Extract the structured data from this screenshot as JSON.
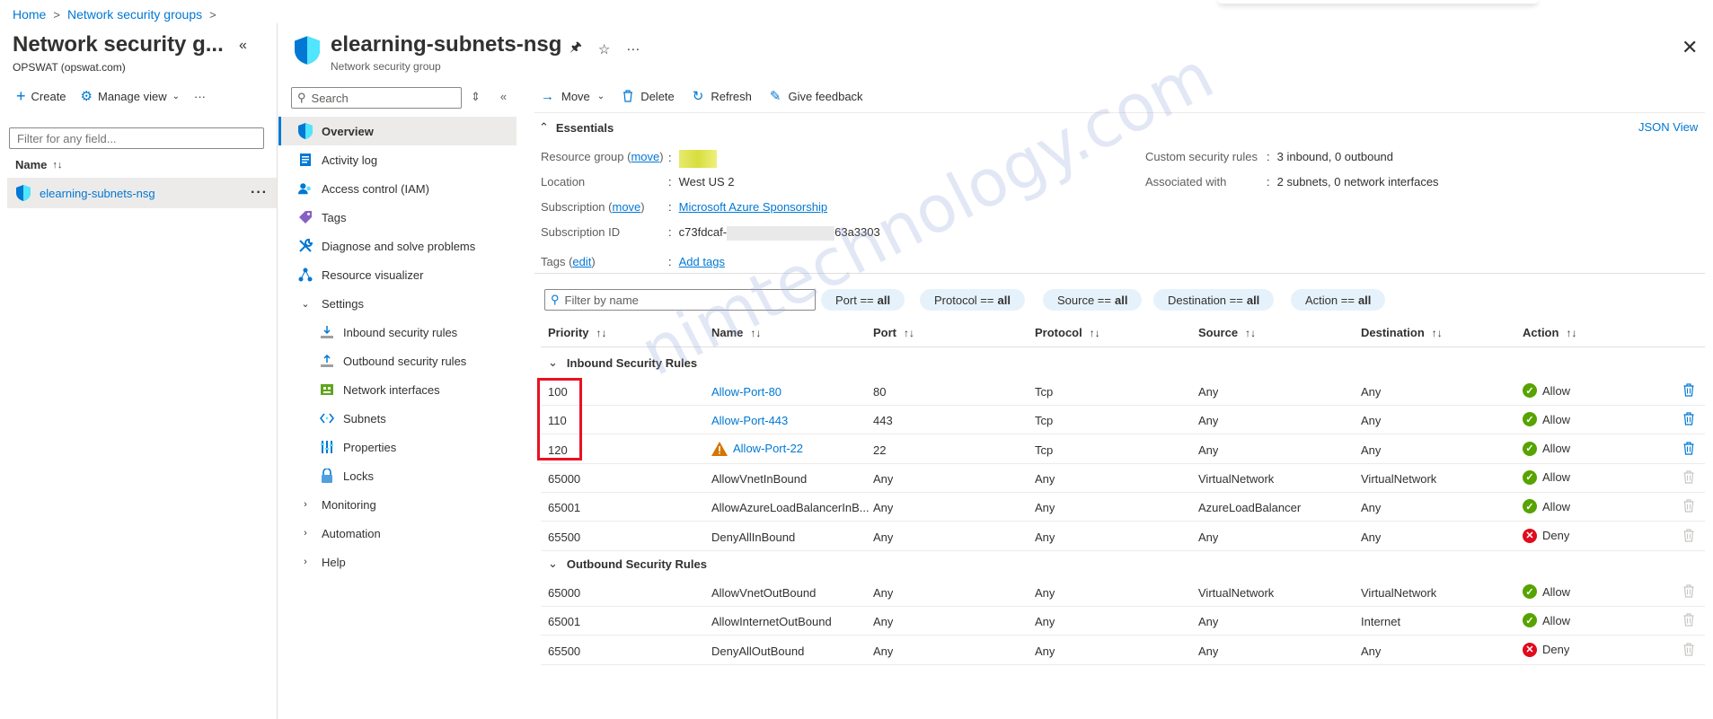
{
  "breadcrumb": {
    "home": "Home",
    "parent": "Network security groups",
    "sep": ">"
  },
  "left_pane": {
    "title": "Network security g...",
    "subtitle": "OPSWAT (opswat.com)",
    "create": "Create",
    "manage_view": "Manage view",
    "more": "···",
    "filter_placeholder": "Filter for any field...",
    "name_header": "Name",
    "item": "elearning-subnets-nsg"
  },
  "resource": {
    "title": "elearning-subnets-nsg",
    "subtitle": "Network security group"
  },
  "menu": {
    "search_placeholder": "Search",
    "items": [
      {
        "label": "Overview",
        "icon": "shield-icon"
      },
      {
        "label": "Activity log",
        "icon": "activity-log-icon"
      },
      {
        "label": "Access control (IAM)",
        "icon": "iam-icon"
      },
      {
        "label": "Tags",
        "icon": "tag-icon"
      },
      {
        "label": "Diagnose and solve problems",
        "icon": "wrench-icon"
      },
      {
        "label": "Resource visualizer",
        "icon": "visualizer-icon"
      },
      {
        "label": "Settings",
        "icon": "chevron-down-icon"
      },
      {
        "label": "Inbound security rules",
        "icon": "inbound-icon"
      },
      {
        "label": "Outbound security rules",
        "icon": "outbound-icon"
      },
      {
        "label": "Network interfaces",
        "icon": "nic-icon"
      },
      {
        "label": "Subnets",
        "icon": "subnet-icon"
      },
      {
        "label": "Properties",
        "icon": "properties-icon"
      },
      {
        "label": "Locks",
        "icon": "lock-icon"
      },
      {
        "label": "Monitoring",
        "icon": "chevron-right-icon"
      },
      {
        "label": "Automation",
        "icon": "chevron-right-icon"
      },
      {
        "label": "Help",
        "icon": "chevron-right-icon"
      }
    ]
  },
  "toolbar": {
    "move": "Move",
    "delete": "Delete",
    "refresh": "Refresh",
    "feedback": "Give feedback"
  },
  "essentials": {
    "title": "Essentials",
    "json_view": "JSON View",
    "resource_group_label": "Resource group",
    "move_link": "move",
    "location_label": "Location",
    "location": "West US 2",
    "subscription_label": "Subscription",
    "subscription": "Microsoft Azure Sponsorship",
    "subscription_id_label": "Subscription ID",
    "subscription_id_start": "c73fdcaf-",
    "subscription_id_end": "63a3303",
    "tags_label": "Tags",
    "edit_link": "edit",
    "add_tags": "Add tags",
    "custom_rules_label": "Custom security rules",
    "custom_rules": "3 inbound, 0 outbound",
    "associated_label": "Associated with",
    "associated": "2 subnets, 0 network interfaces"
  },
  "filters": {
    "placeholder": "Filter by name",
    "pills": [
      {
        "key": "Port ==",
        "val": "all"
      },
      {
        "key": "Protocol ==",
        "val": "all"
      },
      {
        "key": "Source ==",
        "val": "all"
      },
      {
        "key": "Destination ==",
        "val": "all"
      },
      {
        "key": "Action ==",
        "val": "all"
      }
    ]
  },
  "table": {
    "columns": [
      "Priority",
      "Name",
      "Port",
      "Protocol",
      "Source",
      "Destination",
      "Action"
    ],
    "inbound_label": "Inbound Security Rules",
    "outbound_label": "Outbound Security Rules",
    "inbound": [
      {
        "priority": "100",
        "name": "Allow-Port-80",
        "port": "80",
        "protocol": "Tcp",
        "source": "Any",
        "destination": "Any",
        "action": "Allow",
        "custom": true,
        "warning": false
      },
      {
        "priority": "110",
        "name": "Allow-Port-443",
        "port": "443",
        "protocol": "Tcp",
        "source": "Any",
        "destination": "Any",
        "action": "Allow",
        "custom": true,
        "warning": false
      },
      {
        "priority": "120",
        "name": "Allow-Port-22",
        "port": "22",
        "protocol": "Tcp",
        "source": "Any",
        "destination": "Any",
        "action": "Allow",
        "custom": true,
        "warning": true
      },
      {
        "priority": "65000",
        "name": "AllowVnetInBound",
        "port": "Any",
        "protocol": "Any",
        "source": "VirtualNetwork",
        "destination": "VirtualNetwork",
        "action": "Allow",
        "custom": false,
        "warning": false
      },
      {
        "priority": "65001",
        "name": "AllowAzureLoadBalancerInB...",
        "port": "Any",
        "protocol": "Any",
        "source": "AzureLoadBalancer",
        "destination": "Any",
        "action": "Allow",
        "custom": false,
        "warning": false
      },
      {
        "priority": "65500",
        "name": "DenyAllInBound",
        "port": "Any",
        "protocol": "Any",
        "source": "Any",
        "destination": "Any",
        "action": "Deny",
        "custom": false,
        "warning": false
      }
    ],
    "outbound": [
      {
        "priority": "65000",
        "name": "AllowVnetOutBound",
        "port": "Any",
        "protocol": "Any",
        "source": "VirtualNetwork",
        "destination": "VirtualNetwork",
        "action": "Allow",
        "custom": false,
        "warning": false
      },
      {
        "priority": "65001",
        "name": "AllowInternetOutBound",
        "port": "Any",
        "protocol": "Any",
        "source": "Any",
        "destination": "Internet",
        "action": "Allow",
        "custom": false,
        "warning": false
      },
      {
        "priority": "65500",
        "name": "DenyAllOutBound",
        "port": "Any",
        "protocol": "Any",
        "source": "Any",
        "destination": "Any",
        "action": "Deny",
        "custom": false,
        "warning": false
      }
    ]
  },
  "watermark": "nimtechnology.com",
  "colors": {
    "accent": "#0078d4",
    "allow": "#57a300",
    "deny": "#e00b1c",
    "highlight": "#e81123"
  }
}
